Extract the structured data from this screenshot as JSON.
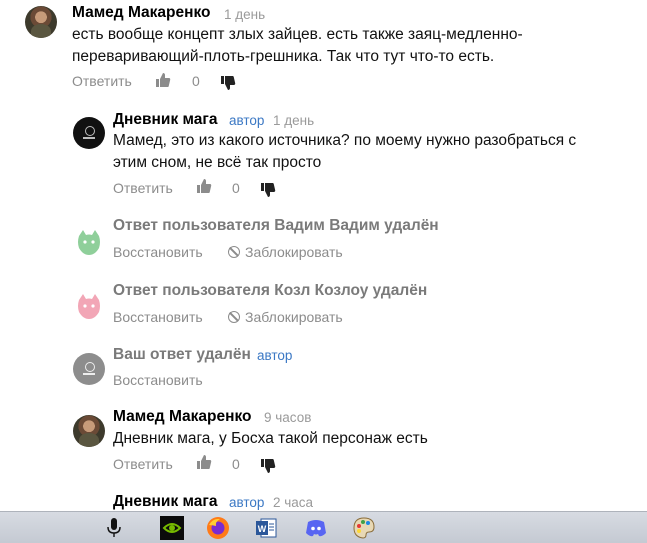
{
  "comments": [
    {
      "author": "Мамед Макаренко",
      "time": "1 день",
      "lines": [
        "есть вообще концепт злых зайцев. есть также заяц-медленно-",
        "переваривающий-плоть-грешника. Так что тут что-то есть."
      ],
      "reply_label": "Ответить",
      "likes": "0"
    },
    {
      "author": "Дневник мага",
      "badge": "автор",
      "time": "1 день",
      "lines": [
        "Мамед, это из какого источника? по моему нужно разобраться с",
        "этим сном, не всё так просто"
      ],
      "reply_label": "Ответить",
      "likes": "0"
    },
    {
      "deleted_text": "Ответ пользователя Вадим Вадим удалён",
      "restore_label": "Восстановить",
      "block_label": "Заблокировать",
      "avatar_color": "#8fcf9a"
    },
    {
      "deleted_text": "Ответ пользователя Козл Козлоу удалён",
      "restore_label": "Восстановить",
      "block_label": "Заблокировать",
      "avatar_color": "#f2a6b6"
    },
    {
      "deleted_text": "Ваш ответ удалён",
      "badge": "автор",
      "restore_label": "Восстановить"
    },
    {
      "author": "Мамед Макаренко",
      "time": "9 часов",
      "lines": [
        "Дневник мага, у Босха такой персонаж есть"
      ],
      "reply_label": "Ответить",
      "likes": "0"
    },
    {
      "author": "Дневник мага",
      "badge": "автор",
      "time": "2 часа"
    }
  ],
  "taskbar": {
    "items": [
      "microphone-icon",
      "nvidia-icon",
      "firefox-icon",
      "word-icon",
      "discord-icon",
      "paint-icon"
    ]
  },
  "colors": {
    "link": "#3b78c4",
    "muted": "#8c8c8c"
  }
}
